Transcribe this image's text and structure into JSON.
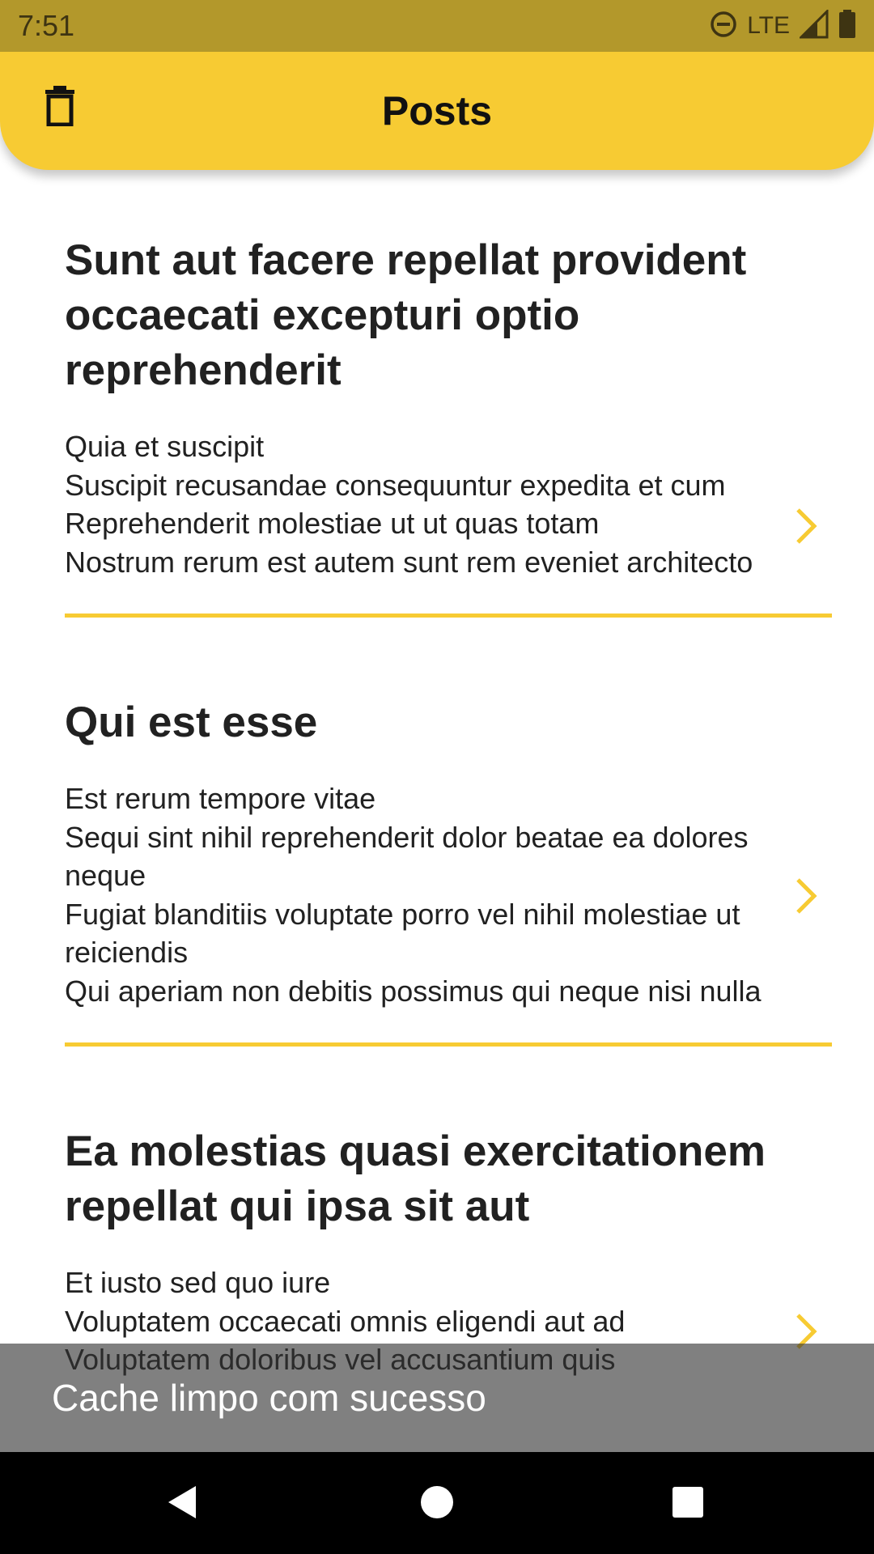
{
  "status_bar": {
    "time": "7:51",
    "network": "LTE",
    "icons": [
      "do-not-disturb-icon",
      "signal-icon",
      "battery-icon"
    ]
  },
  "app_bar": {
    "title": "Posts",
    "action_icon": "delete-icon"
  },
  "posts": [
    {
      "title": "Sunt aut facere repellat provident occaecati excepturi optio reprehenderit",
      "body": "Quia et suscipit\nSuscipit recusandae consequuntur expedita et cum\nReprehenderit molestiae ut ut quas totam\nNostrum rerum est autem sunt rem eveniet architecto"
    },
    {
      "title": "Qui est esse",
      "body": "Est rerum tempore vitae\nSequi sint nihil reprehenderit dolor beatae ea dolores neque\nFugiat blanditiis voluptate porro vel nihil molestiae ut reiciendis\nQui aperiam non debitis possimus qui neque nisi nulla"
    },
    {
      "title": "Ea molestias quasi exercitationem repellat qui ipsa sit aut",
      "body": "Et iusto sed quo iure\nVoluptatem occaecati omnis eligendi aut ad\nVoluptatem doloribus vel accusantium quis"
    }
  ],
  "snackbar": {
    "message": "Cache limpo com sucesso"
  },
  "colors": {
    "accent": "#f7cb33",
    "status_bar": "#b3982b",
    "text": "#212121",
    "nav_bar": "#000000"
  },
  "nav_bar": {
    "icons": [
      "back-icon",
      "home-icon",
      "recents-icon"
    ]
  }
}
